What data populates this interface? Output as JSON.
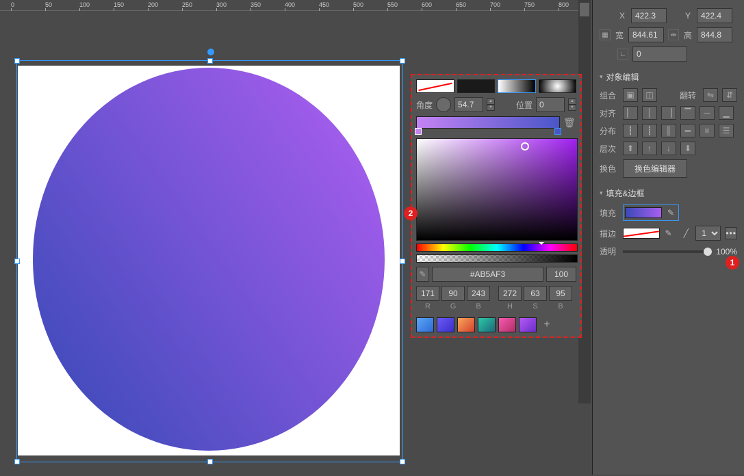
{
  "ruler_ticks": [
    "0",
    "50",
    "100",
    "150",
    "200",
    "250",
    "300",
    "350",
    "400",
    "450",
    "500",
    "550",
    "600",
    "650",
    "700",
    "750",
    "800"
  ],
  "transform": {
    "x_label": "X",
    "x_val": "422.3",
    "y_label": "Y",
    "y_val": "422.4",
    "w_label": "宽",
    "w_val": "844.61",
    "h_label": "高",
    "h_val": "844.8",
    "corner_val": "0"
  },
  "sections": {
    "object_edit": "对象编辑",
    "fill_stroke": "填充&边框"
  },
  "rows": {
    "group": "组合",
    "flip": "翻转",
    "align": "对齐",
    "distribute": "分布",
    "layer": "层次",
    "recolor": "换色",
    "recolor_btn": "换色编辑器",
    "fill": "填充",
    "stroke": "描边",
    "opacity": "透明"
  },
  "stroke_width": "1",
  "opacity_val": "100%",
  "popup": {
    "angle_label": "角度",
    "angle_val": "54.7",
    "pos_label": "位置",
    "pos_val": "0",
    "hex": "#AB5AF3",
    "alpha": "100",
    "r": "171",
    "g": "90",
    "b": "243",
    "h": "272",
    "s": "63",
    "br": "95",
    "lbl_r": "R",
    "lbl_g": "G",
    "lbl_b": "B",
    "lbl_h": "H",
    "lbl_s": "S",
    "lbl_br": "B"
  },
  "markers": {
    "m1": "1",
    "m2": "2"
  },
  "presets": [
    "linear-gradient(135deg,#5aa6f7,#2e6bd6)",
    "linear-gradient(135deg,#6a5af7,#3b2ec8)",
    "linear-gradient(135deg,#f7a65a,#d6412e)",
    "linear-gradient(135deg,#2ec8a8,#1a6b7a)",
    "linear-gradient(135deg,#f75ab0,#b02e66)",
    "linear-gradient(135deg,#b55af7,#6a2ec8)"
  ]
}
